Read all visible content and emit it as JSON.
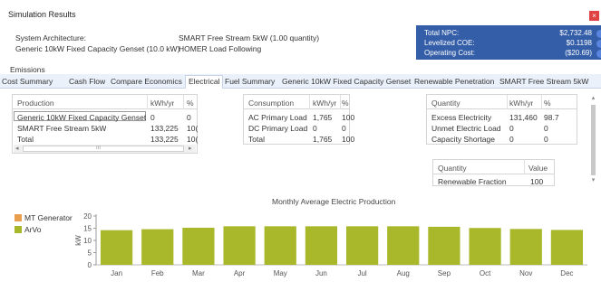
{
  "window": {
    "title": "Simulation Results",
    "close_label": "×"
  },
  "architecture": {
    "label": "System Architecture:",
    "value": "SMART Free Stream 5kW (1.00 quantity)",
    "genset": "Generic 10kW Fixed Capacity Genset (10.0 kW)",
    "strategy": "HOMER Load Following"
  },
  "summary": {
    "npc_label": "Total NPC:",
    "npc_value": "$2,732.48",
    "coe_label": "Levelized COE:",
    "coe_value": "$0.1198",
    "opcost_label": "Operating Cost:",
    "opcost_value": "($20.69)",
    "accent": "#355ea8"
  },
  "emissions_label": "Emissions",
  "tabs": [
    "Cost Summary",
    "Cash Flow",
    "Compare Economics",
    "Electrical",
    "Fuel Summary",
    "Generic 10kW Fixed Capacity Genset",
    "Renewable Penetration",
    "SMART Free Stream 5kW"
  ],
  "active_tab": "Electrical",
  "production": {
    "headers": [
      "Production",
      "kWh/yr",
      "%"
    ],
    "rows": [
      [
        "Generic 10kW Fixed Capacity Genset",
        "0",
        "0"
      ],
      [
        "SMART Free Stream 5kW",
        "133,225",
        "10("
      ],
      [
        "Total",
        "133,225",
        "10("
      ]
    ],
    "scroll_left": "◂",
    "scroll_thumb": "III",
    "scroll_right": "▸"
  },
  "consumption": {
    "headers": [
      "Consumption",
      "kWh/yr",
      "%"
    ],
    "rows": [
      [
        "AC Primary Load",
        "1,765",
        "100"
      ],
      [
        "DC Primary Load",
        "0",
        "0"
      ],
      [
        "Total",
        "1,765",
        "100"
      ]
    ]
  },
  "quantity": {
    "headers": [
      "Quantity",
      "kWh/yr",
      "%"
    ],
    "rows": [
      [
        "Excess Electricity",
        "131,460",
        "98.7"
      ],
      [
        "Unmet Electric Load",
        "0",
        "0"
      ],
      [
        "Capacity Shortage",
        "0",
        "0"
      ]
    ]
  },
  "renewable": {
    "headers": [
      "Quantity",
      "Value"
    ],
    "rows": [
      [
        "Renewable Fraction",
        "100"
      ]
    ]
  },
  "legend": [
    {
      "name": "MT Generator",
      "color": "#e8a04e"
    },
    {
      "name": "ArVo",
      "color": "#a9b82a"
    }
  ],
  "chart_data": {
    "type": "bar",
    "title": "Monthly Average Electric Production",
    "ylabel": "kW",
    "ylim": [
      0,
      20
    ],
    "yticks": [
      0,
      5,
      10,
      15,
      20
    ],
    "categories": [
      "Jan",
      "Feb",
      "Mar",
      "Apr",
      "May",
      "Jun",
      "Jul",
      "Aug",
      "Sep",
      "Oct",
      "Nov",
      "Dec"
    ],
    "series": [
      {
        "name": "MT Generator",
        "color": "#e8a04e",
        "values": [
          0,
          0,
          0,
          0,
          0,
          0,
          0,
          0,
          0,
          0,
          0,
          0
        ]
      },
      {
        "name": "ArVo",
        "color": "#a9b82a",
        "values": [
          14.2,
          14.6,
          15.2,
          15.8,
          15.8,
          15.8,
          15.8,
          15.8,
          15.6,
          15.1,
          14.7,
          14.3
        ]
      }
    ]
  }
}
